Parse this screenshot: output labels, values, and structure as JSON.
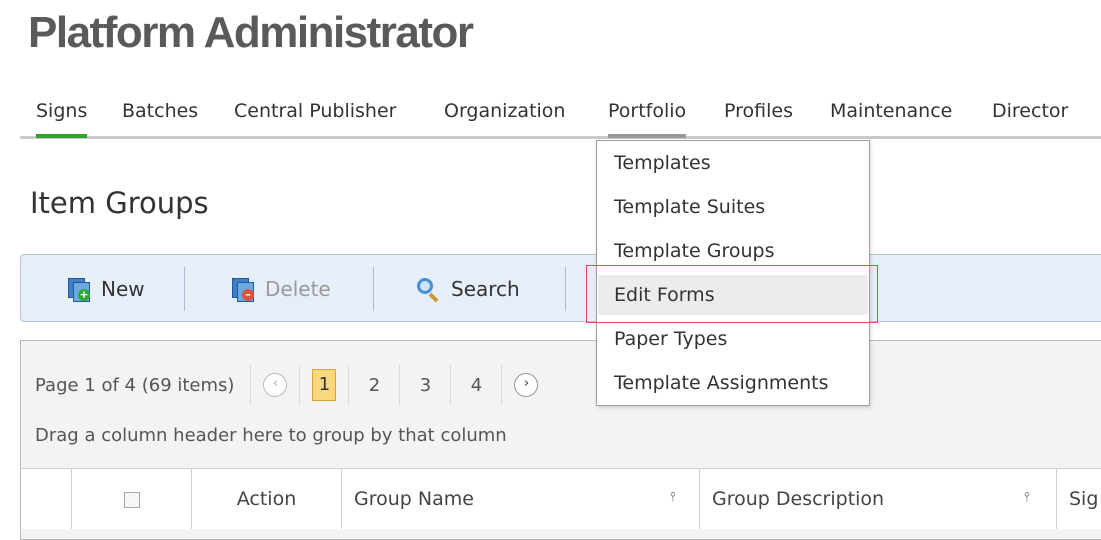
{
  "app": {
    "title": "Platform Administrator"
  },
  "nav": {
    "items": [
      {
        "label": "Signs"
      },
      {
        "label": "Batches"
      },
      {
        "label": "Central Publisher"
      },
      {
        "label": "Organization"
      },
      {
        "label": "Portfolio"
      },
      {
        "label": "Profiles"
      },
      {
        "label": "Maintenance"
      },
      {
        "label": "Director"
      }
    ],
    "active": "Signs",
    "open_menu": "Portfolio"
  },
  "page": {
    "title": "Item Groups"
  },
  "toolbar": {
    "new_label": "New",
    "delete_label": "Delete",
    "search_label": "Search"
  },
  "portfolio_menu": {
    "items": [
      {
        "label": "Templates"
      },
      {
        "label": "Template Suites"
      },
      {
        "label": "Template Groups"
      },
      {
        "label": "Edit Forms"
      },
      {
        "label": "Paper Types"
      },
      {
        "label": "Template Assignments"
      }
    ],
    "hovered": "Edit Forms"
  },
  "pager": {
    "info": "Page 1 of 4 (69 items)",
    "prev": "‹",
    "next": "›",
    "pages": [
      "1",
      "2",
      "3",
      "4"
    ],
    "current": "1"
  },
  "grid": {
    "group_hint": "Drag a column header here to group by that column",
    "columns": {
      "action": "Action",
      "group_name": "Group Name",
      "group_description": "Group Description",
      "sig": "Sig"
    },
    "filter_icon": "filter-icon"
  },
  "colors": {
    "active_tab": "#2ea32e",
    "toolbar_bg": "#e6eef8",
    "current_page": "#f9d77c",
    "highlight_box": "#d9534f"
  }
}
